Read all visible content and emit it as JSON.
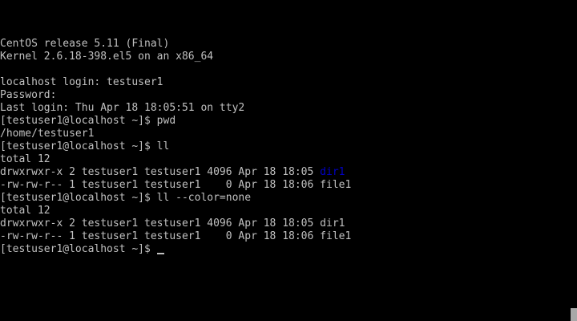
{
  "console": {
    "lines": [
      {
        "name": "os-release-line",
        "text": "CentOS release 5.11 (Final)"
      },
      {
        "name": "kernel-line",
        "text": "Kernel 2.6.18-398.el5 on an x86_64"
      },
      {
        "name": "blank-line",
        "text": ""
      },
      {
        "name": "login-prompt-line",
        "text": "localhost login: testuser1"
      },
      {
        "name": "password-prompt-line",
        "text": "Password:"
      },
      {
        "name": "last-login-line",
        "text": "Last login: Thu Apr 18 18:05:51 on tty2"
      },
      {
        "name": "command-pwd-line",
        "text": "[testuser1@localhost ~]$ pwd"
      },
      {
        "name": "pwd-output-line",
        "text": "/home/testuser1"
      },
      {
        "name": "command-ll-line",
        "text": "[testuser1@localhost ~]$ ll"
      },
      {
        "name": "total-line",
        "text": "total 12"
      },
      {
        "name": "listing-row-dir1",
        "prefix": "drwxrwxr-x 2 testuser1 testuser1 4096 Apr 18 18:05 ",
        "colored": "dir1"
      },
      {
        "name": "listing-row-file1",
        "text": "-rw-rw-r-- 1 testuser1 testuser1    0 Apr 18 18:06 file1"
      },
      {
        "name": "command-ll-nocolor-line",
        "text": "[testuser1@localhost ~]$ ll --color=none"
      },
      {
        "name": "total-line",
        "text": "total 12"
      },
      {
        "name": "listing-row-dir1",
        "text": "drwxrwxr-x 2 testuser1 testuser1 4096 Apr 18 18:05 dir1"
      },
      {
        "name": "listing-row-file1",
        "text": "-rw-rw-r-- 1 testuser1 testuser1    0 Apr 18 18:06 file1"
      },
      {
        "name": "current-prompt-line",
        "text": "[testuser1@localhost ~]$ ",
        "cursor": true
      }
    ]
  },
  "colors": {
    "background": "#000000",
    "foreground": "#c0c0c0",
    "directory": "#0000c8"
  }
}
